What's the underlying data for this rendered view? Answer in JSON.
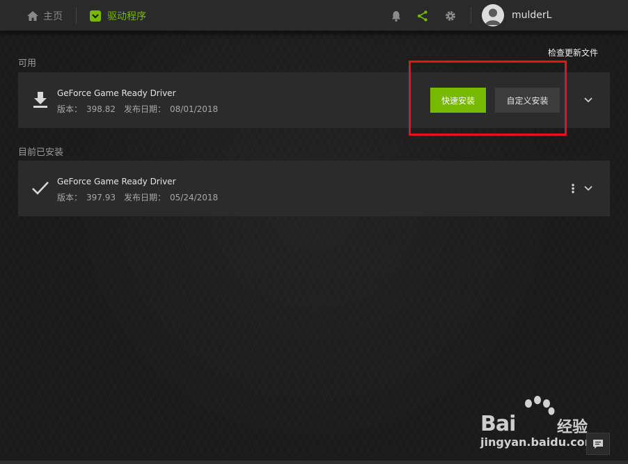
{
  "nav": {
    "home_label": "主页",
    "drivers_label": "驱动程序",
    "username": "mulderL"
  },
  "actions": {
    "check_updates": "检查更新文件"
  },
  "available": {
    "section_label": "可用",
    "driver_name": "GeForce Game Ready Driver",
    "version_label": "版本：",
    "version": "398.82",
    "date_label": "发布日期：",
    "date": "08/01/2018",
    "express_install": "快速安装",
    "custom_install": "自定义安装"
  },
  "installed": {
    "section_label": "目前已安装",
    "driver_name": "GeForce Game Ready Driver",
    "version_label": "版本：",
    "version": "397.93",
    "date_label": "发布日期：",
    "date": "05/24/2018"
  },
  "watermark": {
    "brand": "Bai",
    "brand_cn": "经验",
    "url": "jingyan.baidu.com"
  },
  "colors": {
    "accent": "#76b900",
    "highlight_box": "#e8141c"
  }
}
